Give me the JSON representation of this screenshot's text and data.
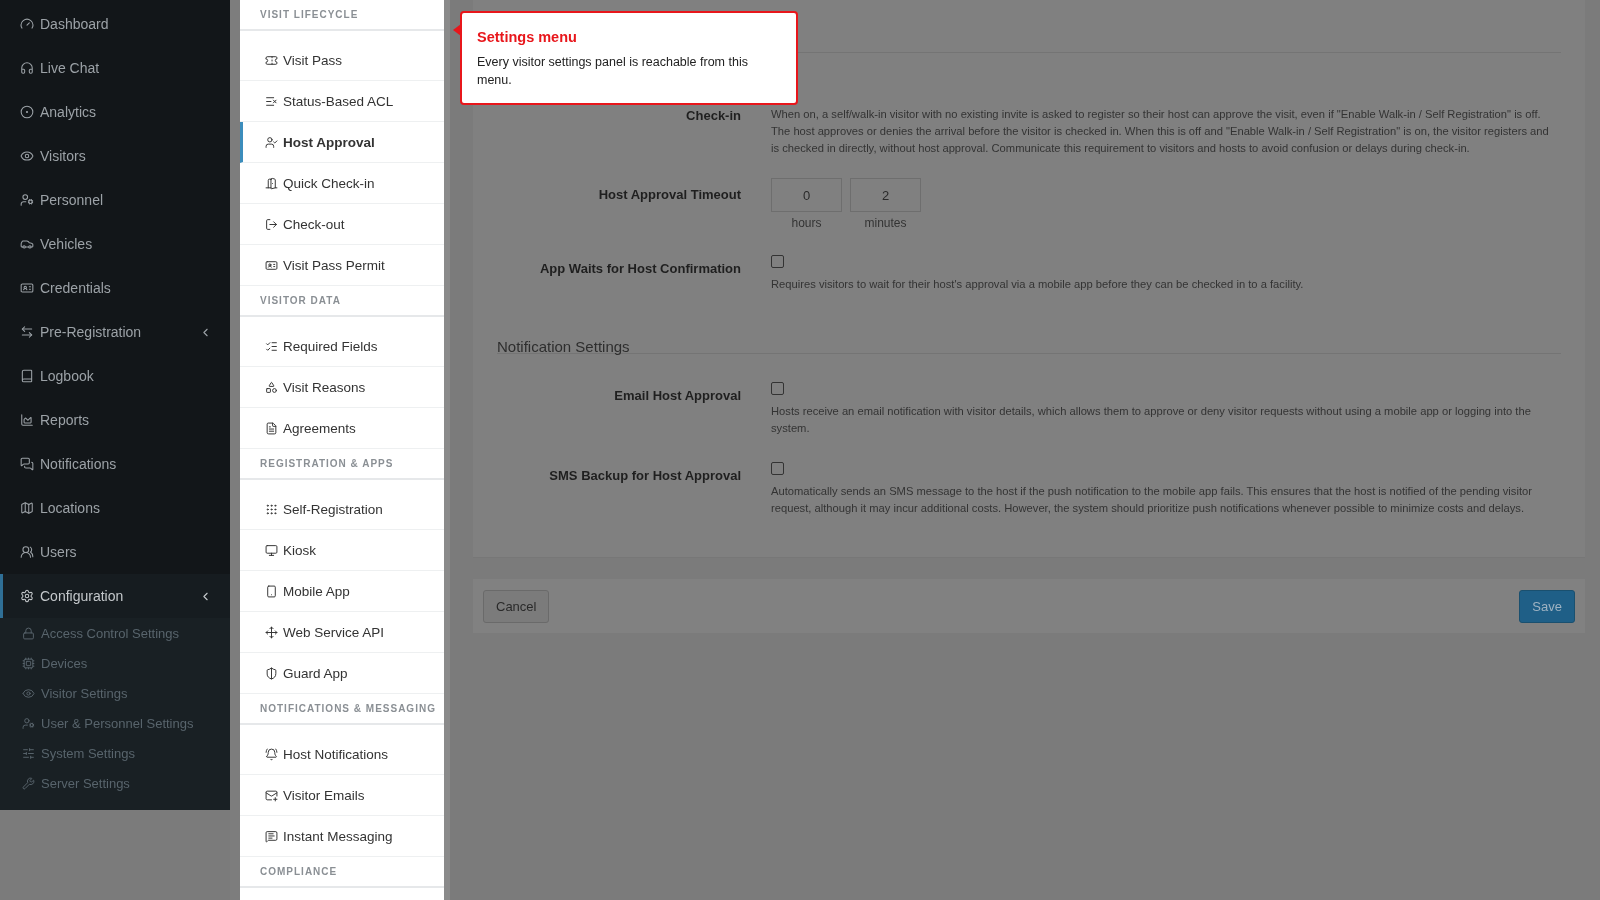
{
  "sidebar": {
    "items": [
      {
        "label": "Dashboard",
        "selected": false,
        "expandable": false
      },
      {
        "label": "Live Chat",
        "selected": false,
        "expandable": false
      },
      {
        "label": "Analytics",
        "selected": false,
        "expandable": false
      },
      {
        "label": "Visitors",
        "selected": false,
        "expandable": false
      },
      {
        "label": "Personnel",
        "selected": false,
        "expandable": false
      },
      {
        "label": "Vehicles",
        "selected": false,
        "expandable": false
      },
      {
        "label": "Credentials",
        "selected": false,
        "expandable": false
      },
      {
        "label": "Pre-Registration",
        "selected": false,
        "expandable": true
      },
      {
        "label": "Logbook",
        "selected": false,
        "expandable": false
      },
      {
        "label": "Reports",
        "selected": false,
        "expandable": false
      },
      {
        "label": "Notifications",
        "selected": false,
        "expandable": false
      },
      {
        "label": "Locations",
        "selected": false,
        "expandable": false
      },
      {
        "label": "Users",
        "selected": false,
        "expandable": false
      },
      {
        "label": "Configuration",
        "selected": true,
        "expandable": true,
        "children": [
          {
            "label": "Access Control Settings",
            "selected": false
          },
          {
            "label": "Devices",
            "selected": false
          },
          {
            "label": "Visitor Settings",
            "selected": false
          },
          {
            "label": "User & Personnel Settings",
            "selected": false
          },
          {
            "label": "System Settings",
            "selected": false
          },
          {
            "label": "Server Settings",
            "selected": false
          }
        ]
      }
    ]
  },
  "settings_menu": {
    "sections": [
      {
        "heading": "VISIT LIFECYCLE",
        "items": [
          {
            "label": "Visit Pass",
            "selected": false
          },
          {
            "label": "Status-Based ACL",
            "selected": false
          },
          {
            "label": "Host Approval",
            "selected": true
          },
          {
            "label": "Quick Check-in",
            "selected": false
          },
          {
            "label": "Check-out",
            "selected": false
          },
          {
            "label": "Visit Pass Permit",
            "selected": false
          }
        ]
      },
      {
        "heading": "VISITOR DATA",
        "items": [
          {
            "label": "Required Fields",
            "selected": false
          },
          {
            "label": "Visit Reasons",
            "selected": false
          },
          {
            "label": "Agreements",
            "selected": false
          }
        ]
      },
      {
        "heading": "REGISTRATION & APPS",
        "items": [
          {
            "label": "Self-Registration",
            "selected": false
          },
          {
            "label": "Kiosk",
            "selected": false
          },
          {
            "label": "Mobile App",
            "selected": false
          },
          {
            "label": "Web Service API",
            "selected": false
          },
          {
            "label": "Guard App",
            "selected": false
          }
        ]
      },
      {
        "heading": "NOTIFICATIONS & MESSAGING",
        "items": [
          {
            "label": "Host Notifications",
            "selected": false
          },
          {
            "label": "Visitor Emails",
            "selected": false
          },
          {
            "label": "Instant Messaging",
            "selected": false
          }
        ]
      },
      {
        "heading": "COMPLIANCE"
      }
    ]
  },
  "tooltip": {
    "title": "Settings menu",
    "text": "Every visitor settings panel is reachable from this menu."
  },
  "form": {
    "groups": [
      {
        "rows": [
          {
            "kind": "note",
            "label": "Check-in",
            "description": "When on, a self/walk-in visitor with no existing invite is asked to register so their host can approve the visit, even if \"Enable Walk-in / Self Registration\" is off. The host approves or denies the arrival before the visitor is checked in. When this is off and \"Enable Walk-in / Self Registration\" is on, the visitor registers and is checked in directly, without host approval. Communicate this requirement to visitors and hosts to avoid confusion or delays during check-in."
          },
          {
            "kind": "duration",
            "label": "Host Approval Timeout",
            "fields": [
              {
                "value": "0",
                "unit": "hours"
              },
              {
                "value": "2",
                "unit": "minutes"
              }
            ]
          },
          {
            "kind": "checkbox",
            "label": "App Waits for Host Confirmation",
            "checked": false,
            "description": "Requires visitors to wait for their host's approval via a mobile app before they can be checked in to a facility."
          }
        ]
      },
      {
        "heading": "Notification Settings",
        "rows": [
          {
            "kind": "checkbox",
            "label": "Email Host Approval",
            "checked": false,
            "description": "Hosts receive an email notification with visitor details, which allows them to approve or deny visitor requests without using a mobile app or logging into the system."
          },
          {
            "kind": "checkbox",
            "label": "SMS Backup for Host Approval",
            "checked": false,
            "description": "Automatically sends an SMS message to the host if the push notification to the mobile app fails. This ensures that the host is notified of the pending visitor request, although it may incur additional costs. However, the system should prioritize push notifications whenever possible to minimize costs and delays."
          }
        ]
      }
    ]
  },
  "footer": {
    "buttons": [
      {
        "label": "Cancel",
        "kind": "secondary"
      },
      {
        "label": "Save",
        "kind": "primary"
      }
    ]
  }
}
